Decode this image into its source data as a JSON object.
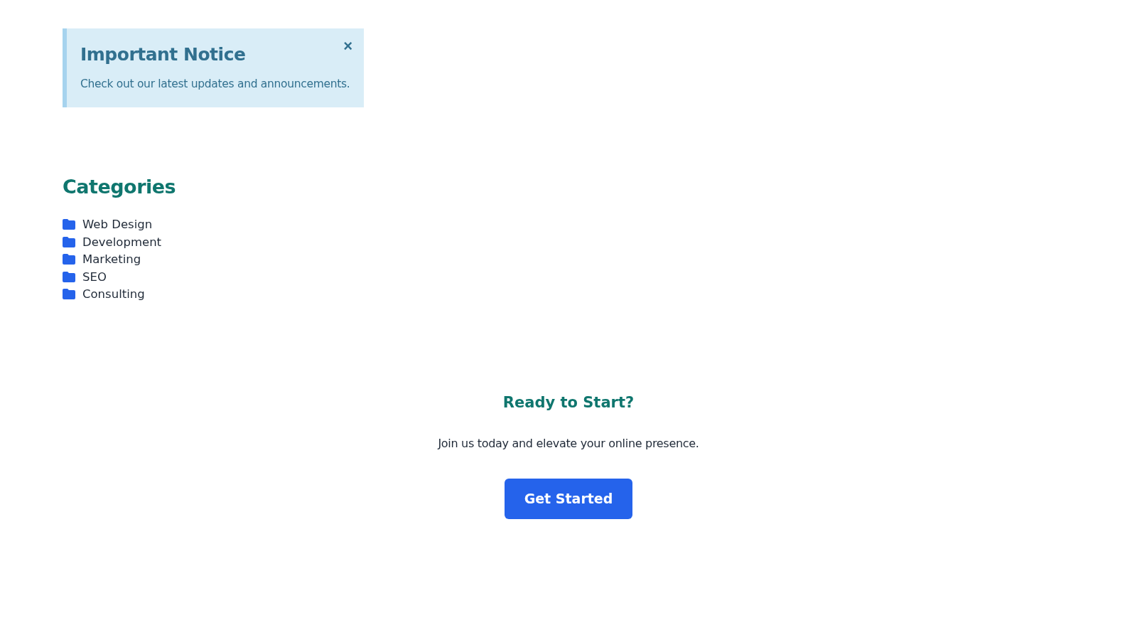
{
  "notice": {
    "title": "Important Notice",
    "message": "Check out our latest updates and announcements.",
    "close": "×"
  },
  "categories": {
    "title": "Categories",
    "items": [
      {
        "label": "Web Design"
      },
      {
        "label": "Development"
      },
      {
        "label": "Marketing"
      },
      {
        "label": "SEO"
      },
      {
        "label": "Consulting"
      }
    ]
  },
  "cta": {
    "title": "Ready to Start?",
    "text": "Join us today and elevate your online presence.",
    "button": "Get Started"
  }
}
